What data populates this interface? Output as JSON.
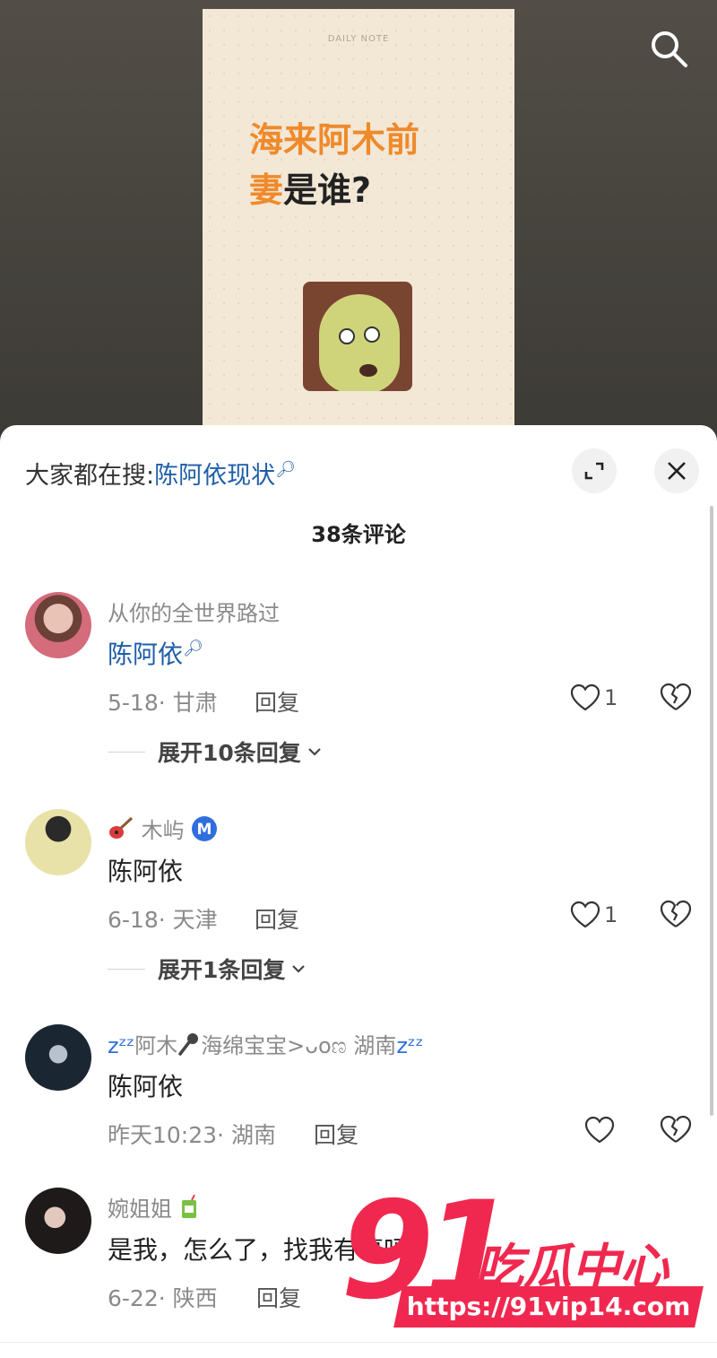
{
  "video": {
    "brand_small": "DAILY NOTE",
    "title_line1": "海来阿木前",
    "title_line2_highlight": "妻",
    "title_line2_rest": "是谁?"
  },
  "comments_panel": {
    "hot_search_prefix": "大家都在搜:",
    "hot_search_term": "陈阿依现状",
    "count_label": "38条评论",
    "reply_label": "回复",
    "comments": [
      {
        "username": "从你的全世界路过",
        "text": "陈阿依",
        "text_is_link": true,
        "meta": "5-18· 甘肃",
        "likes": "1",
        "replies_label": "展开10条回复"
      },
      {
        "username": "木屿",
        "username_prefix_icon": "guitar-emoji",
        "username_badge_icon": "m-badge-icon",
        "text": "陈阿依",
        "meta": "6-18· 天津",
        "likes": "1",
        "replies_label": "展开1条回复"
      },
      {
        "username_prefix": "zᶻᶻ",
        "username_part1": "阿木",
        "username_part2": "海绵宝宝>ᴗoಣ 湖南",
        "username_suffix": "zᶻᶻ",
        "text": "陈阿依",
        "meta": "昨天10:23· 湖南",
        "likes": ""
      },
      {
        "username": "婉姐姐",
        "username_suffix_icon": "juice-box-emoji",
        "text": "是我，怎么了，找我有事吗?",
        "meta": "6-22· 陕西"
      }
    ]
  },
  "watermark": {
    "number": "91",
    "chinese": "吃瓜中心",
    "url": "https://91vip14.com"
  },
  "colors": {
    "link_blue": "#1f5ea8",
    "accent_orange": "#ef8a2c",
    "watermark_red": "#f0284f"
  }
}
